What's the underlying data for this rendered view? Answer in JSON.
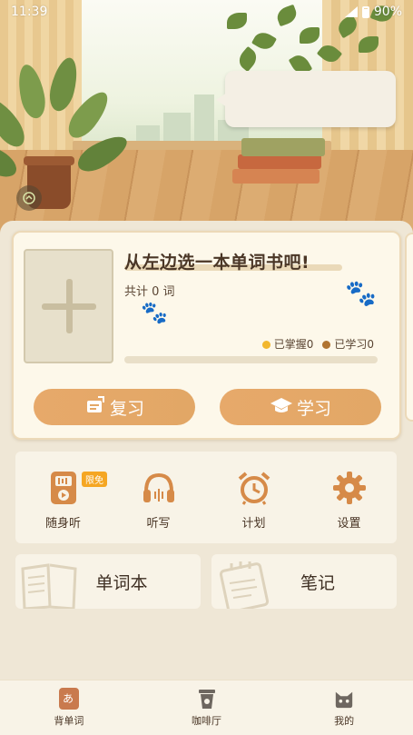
{
  "status_bar": {
    "time": "11:39",
    "battery": "90%"
  },
  "book_card": {
    "title": "从左边选一本单词书吧!",
    "word_count": "共计 0 词",
    "mastered_label": "已掌握0",
    "learned_label": "已学习0",
    "progress": 0,
    "review_label": "复习",
    "study_label": "学习"
  },
  "tools": [
    {
      "label": "随身听",
      "badge": "限免",
      "icon": "walkman-icon"
    },
    {
      "label": "听写",
      "icon": "headphones-icon"
    },
    {
      "label": "计划",
      "icon": "alarm-clock-icon"
    },
    {
      "label": "设置",
      "icon": "gear-icon"
    }
  ],
  "cards": {
    "wordbook": "单词本",
    "notes": "笔记"
  },
  "nav": [
    {
      "label": "背单词",
      "icon": "vocab-icon",
      "active": true
    },
    {
      "label": "咖啡厅",
      "icon": "coffee-cup-icon"
    },
    {
      "label": "我的",
      "icon": "cat-icon"
    }
  ],
  "colors": {
    "accent": "#e3a55e",
    "mastered_dot": "#f2b72e",
    "learned_dot": "#b07431",
    "tool_icon": "#d68a48",
    "badge": "#f5a623"
  }
}
